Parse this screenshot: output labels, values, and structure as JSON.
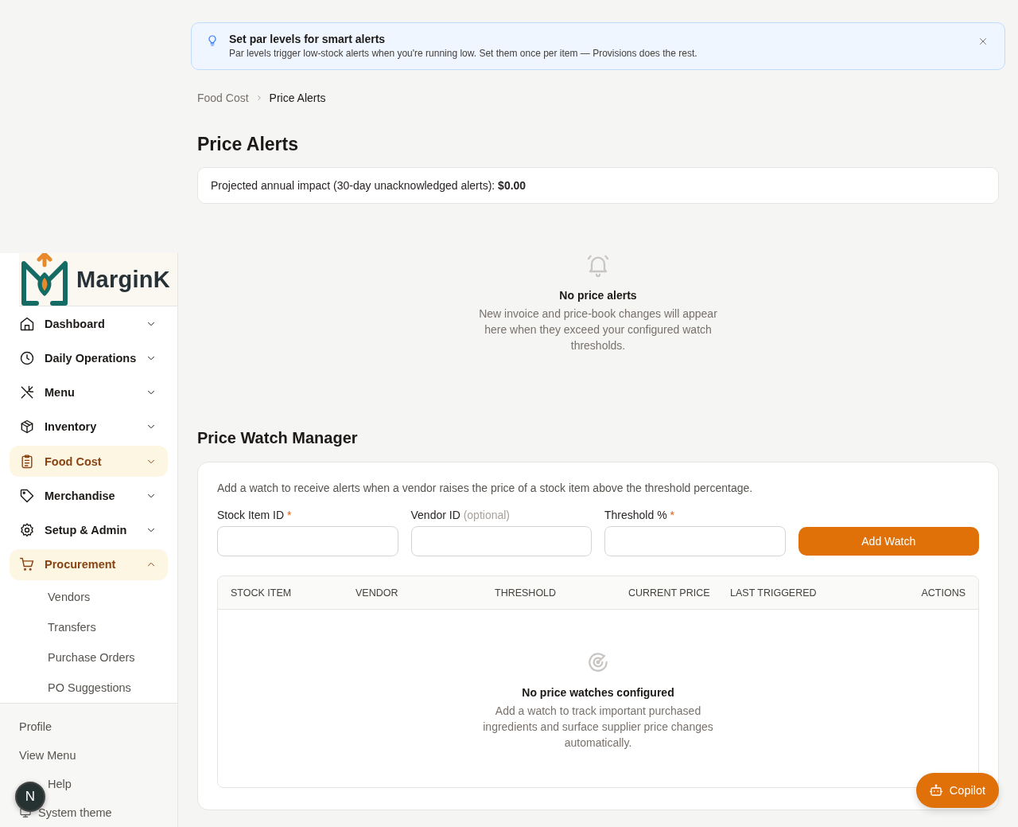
{
  "banner": {
    "title": "Set par levels for smart alerts",
    "text": "Par levels trigger low-stock alerts when you're running low. Set them once per item — Provisions does the rest."
  },
  "breadcrumb": [
    {
      "label": "Food Cost",
      "current": false
    },
    {
      "label": "Price Alerts",
      "current": true
    }
  ],
  "page_title": "Price Alerts",
  "impact": "Projected annual impact (30-day unacknowledged alerts): **$0.00**",
  "alerts_empty": {
    "title": "No price alerts",
    "text": "New invoice and price-book changes will appear here when they exceed your configured watch thresholds."
  },
  "watch_manager": {
    "title": "Price Watch Manager",
    "description": "Add a watch to receive alerts when a vendor raises the price of a stock item above the threshold percentage.",
    "fields": [
      {
        "label": "Stock Item ID",
        "marker": "*"
      },
      {
        "label": "Vendor ID",
        "hint": "(optional)"
      },
      {
        "label": "Threshold %",
        "marker": "*"
      }
    ],
    "button": "Add Watch",
    "table": {
      "columns": [
        "STOCK ITEM",
        "VENDOR",
        "THRESHOLD",
        "CURRENT PRICE",
        "LAST TRIGGERED",
        "ACTIONS"
      ],
      "empty": {
        "title": "No price watches configured",
        "text": "Add a watch to track important purchased ingredients and surface supplier price changes automatically."
      }
    }
  },
  "sidebar": {
    "brand": "MarginK",
    "items": [
      {
        "label": "Dashboard",
        "selected": false,
        "expanded": false
      },
      {
        "label": "Daily Operations",
        "selected": false,
        "expanded": false
      },
      {
        "label": "Menu",
        "selected": false,
        "expanded": false
      },
      {
        "label": "Inventory",
        "selected": false,
        "expanded": false
      },
      {
        "label": "Food Cost",
        "selected": true,
        "expanded": false
      },
      {
        "label": "Merchandise",
        "selected": false,
        "expanded": false
      },
      {
        "label": "Setup & Admin",
        "selected": false,
        "expanded": false
      },
      {
        "label": "Procurement",
        "selected": true,
        "expanded": true,
        "children": [
          {
            "label": "Vendors"
          },
          {
            "label": "Transfers"
          },
          {
            "label": "Purchase Orders"
          },
          {
            "label": "PO Suggestions"
          }
        ]
      }
    ],
    "footer": [
      {
        "label": "Profile"
      },
      {
        "label": "View Menu"
      },
      {
        "label": "Help"
      },
      {
        "label": "System theme"
      }
    ]
  },
  "dev_badge": "N",
  "copilot": "Copilot"
}
